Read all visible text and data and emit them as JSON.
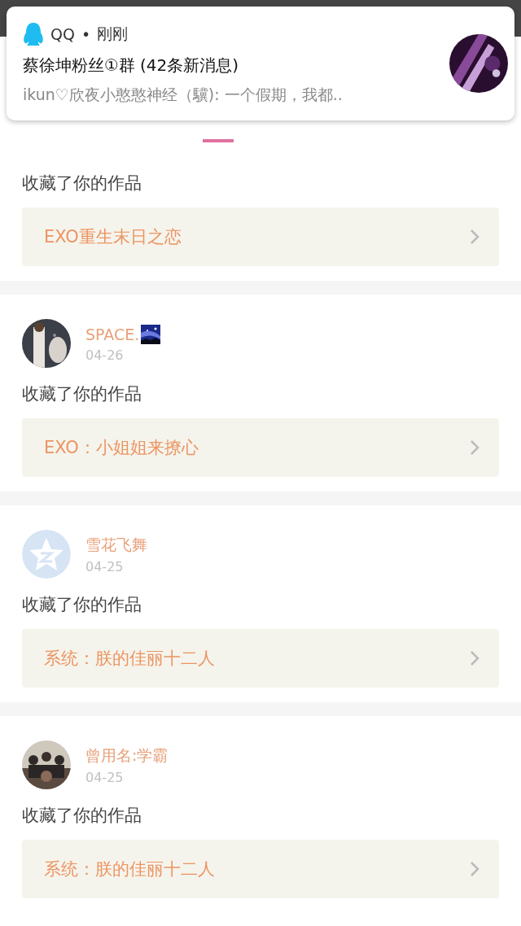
{
  "notification": {
    "app": "QQ",
    "separator": "•",
    "time": "刚刚",
    "title": "蔡徐坤粉丝①群",
    "count": "(42条新消息)",
    "message": "ikun♡欣夜小憨憨神经（驥): 一个假期，我都.."
  },
  "tabs": [
    {
      "selected": false
    },
    {
      "selected": false
    },
    {
      "selected": true
    },
    {
      "selected": false
    },
    {
      "selected": false
    },
    {
      "selected": false
    }
  ],
  "feed": [
    {
      "action": "收藏了你的作品",
      "work": "EXO重生末日之恋"
    },
    {
      "user": "SPACE.",
      "badge": true,
      "date": "04-26",
      "action": "收藏了你的作品",
      "work": "EXO：小姐姐来撩心"
    },
    {
      "user": "雪花飞舞",
      "badge": false,
      "date": "04-25",
      "avatar": {
        "kind": "default"
      },
      "action": "收藏了你的作品",
      "work": "系统：朕的佳丽十二人"
    },
    {
      "user": "曾用名:学霸",
      "badge": false,
      "date": "04-25",
      "action": "收藏了你的作品",
      "work": "系统：朕的佳丽十二人"
    }
  ]
}
